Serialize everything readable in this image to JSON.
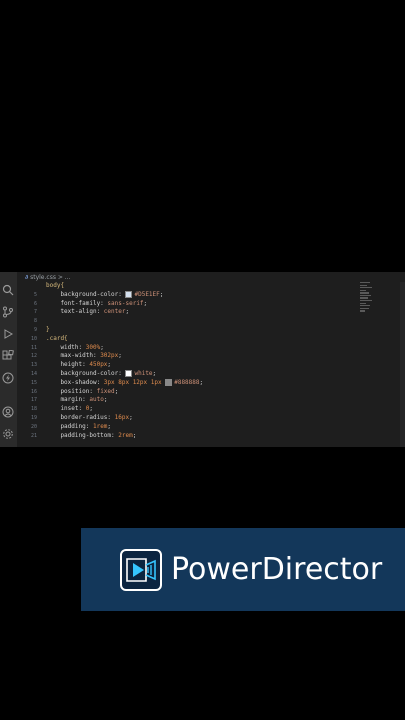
{
  "editor": {
    "breadcrumb": "style.css > ...",
    "activity_icons": [
      "search-icon",
      "source-control-icon",
      "run-debug-icon",
      "extensions-icon",
      "lightning-icon",
      "account-icon",
      "settings-icon"
    ],
    "line_numbers": [
      "5",
      "6",
      "7",
      "8",
      "9",
      "10",
      "11",
      "12",
      "13",
      "14",
      "15",
      "16",
      "17",
      "18",
      "19",
      "20",
      "21"
    ],
    "lines": [
      [
        {
          "t": "body{",
          "c": "sel"
        }
      ],
      [
        {
          "t": "    background-color: ",
          "c": "prop"
        },
        {
          "sw": "#D5E1EF"
        },
        {
          "t": "#D5E1EF",
          "c": "val"
        },
        {
          "t": ";",
          "c": "prop"
        }
      ],
      [
        {
          "t": "    font-family: ",
          "c": "prop"
        },
        {
          "t": "sans-serif",
          "c": "val"
        },
        {
          "t": ";",
          "c": "prop"
        }
      ],
      [
        {
          "t": "    text-align: ",
          "c": "prop"
        },
        {
          "t": "center",
          "c": "val"
        },
        {
          "t": ";",
          "c": "prop"
        }
      ],
      [
        {
          "t": "",
          "c": "prop"
        }
      ],
      [
        {
          "t": "}",
          "c": "sel"
        }
      ],
      [
        {
          "t": ".card{",
          "c": "sel"
        }
      ],
      [
        {
          "t": "    width: ",
          "c": "prop"
        },
        {
          "t": "300%",
          "c": "num"
        },
        {
          "t": ";",
          "c": "prop"
        }
      ],
      [
        {
          "t": "    max-width: ",
          "c": "prop"
        },
        {
          "t": "302px",
          "c": "num"
        },
        {
          "t": ";",
          "c": "prop"
        }
      ],
      [
        {
          "t": "    height: ",
          "c": "prop"
        },
        {
          "t": "450px",
          "c": "num"
        },
        {
          "t": ";",
          "c": "prop"
        }
      ],
      [
        {
          "t": "    background-color: ",
          "c": "prop"
        },
        {
          "sw": "#ffffff"
        },
        {
          "t": "white",
          "c": "val"
        },
        {
          "t": ";",
          "c": "prop"
        }
      ],
      [
        {
          "t": "    box-shadow: ",
          "c": "prop"
        },
        {
          "t": "3px 8px 12px 1px ",
          "c": "num"
        },
        {
          "sw": "#888888"
        },
        {
          "t": "#888888",
          "c": "val"
        },
        {
          "t": ";",
          "c": "prop"
        }
      ],
      [
        {
          "t": "    position: ",
          "c": "prop"
        },
        {
          "t": "fixed",
          "c": "val"
        },
        {
          "t": ";",
          "c": "prop"
        }
      ],
      [
        {
          "t": "    margin: ",
          "c": "prop"
        },
        {
          "t": "auto",
          "c": "val"
        },
        {
          "t": ";",
          "c": "prop"
        }
      ],
      [
        {
          "t": "    inset: ",
          "c": "prop"
        },
        {
          "t": "0",
          "c": "num"
        },
        {
          "t": ";",
          "c": "prop"
        }
      ],
      [
        {
          "t": "    border-radius: ",
          "c": "prop"
        },
        {
          "t": "16px",
          "c": "num"
        },
        {
          "t": ";",
          "c": "prop"
        }
      ],
      [
        {
          "t": "    padding: ",
          "c": "prop"
        },
        {
          "t": "1rem",
          "c": "num"
        },
        {
          "t": ";",
          "c": "prop"
        }
      ],
      [
        {
          "t": "    padding-bottom: ",
          "c": "prop"
        },
        {
          "t": "2rem",
          "c": "num"
        },
        {
          "t": ";",
          "c": "prop"
        }
      ]
    ]
  },
  "watermark": {
    "brand": "PowerDirector",
    "logo_icon": "powerdirector-logo-icon",
    "background": "#13375a"
  }
}
